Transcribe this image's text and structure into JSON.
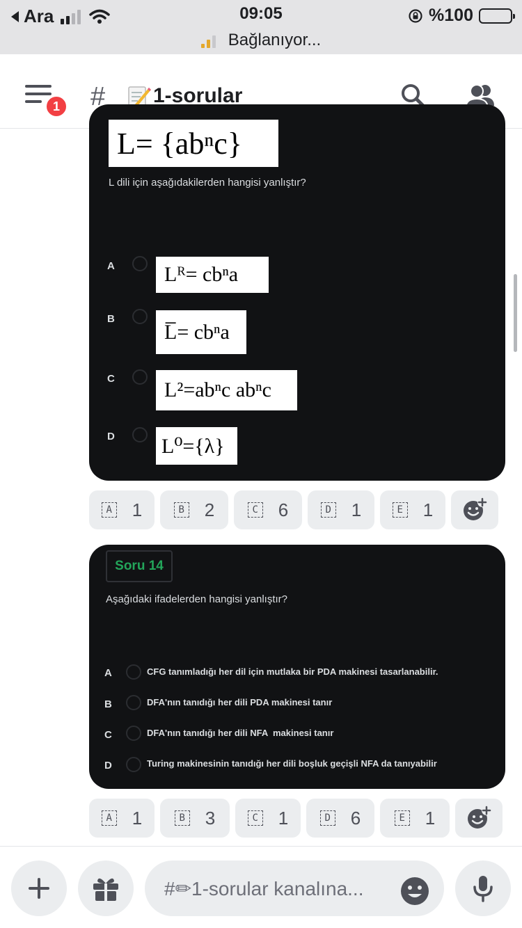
{
  "status_bar": {
    "carrier": "Ara",
    "time": "09:05",
    "battery": "%100",
    "connection_text": "Bağlanıyor..."
  },
  "header": {
    "notification_count": "1",
    "channel_hash": "#",
    "channel_name": "1-sorular",
    "icons": [
      "menu-icon",
      "memo-emoji-icon",
      "search-icon",
      "members-icon"
    ]
  },
  "message1": {
    "header_formula": "L= {abⁿc}",
    "question": "L dili için aşağıdakilerden hangisi yanlıştır?",
    "options": [
      {
        "letter": "A",
        "formula": "Lᴿ= cbⁿa"
      },
      {
        "letter": "B",
        "formula": "L̅= cbⁿa"
      },
      {
        "letter": "C",
        "formula": "L²=abⁿc abⁿc"
      },
      {
        "letter": "D",
        "formula": "L⁰={λ}"
      }
    ],
    "reactions": [
      {
        "emoji": "A",
        "count": "1"
      },
      {
        "emoji": "B",
        "count": "2"
      },
      {
        "emoji": "C",
        "count": "6"
      },
      {
        "emoji": "D",
        "count": "1"
      },
      {
        "emoji": "E",
        "count": "1"
      }
    ]
  },
  "message2": {
    "tag": "Soru 14",
    "question": "Aşağıdaki ifadelerden hangisi yanlıştır?",
    "options": [
      {
        "letter": "A",
        "text": "CFG tanımladığı her dil için mutlaka bir PDA makinesi tasarlanabilir."
      },
      {
        "letter": "B",
        "text": "DFA'nın tanıdığı her dili PDA makinesi tanır"
      },
      {
        "letter": "C",
        "text": "DFA'nın tanıdığı her dili NFA  makinesi tanır"
      },
      {
        "letter": "D",
        "text": "Turing makinesinin tanıdığı her dili boşluk geçişli NFA da tanıyabilir"
      }
    ],
    "reactions": [
      {
        "emoji": "A",
        "count": "1"
      },
      {
        "emoji": "B",
        "count": "3"
      },
      {
        "emoji": "C",
        "count": "1"
      },
      {
        "emoji": "D",
        "count": "6"
      },
      {
        "emoji": "E",
        "count": "1"
      }
    ]
  },
  "composer": {
    "placeholder": "#✏1-sorular kanalına..."
  },
  "colors": {
    "card_bg": "#111214",
    "accent_green": "#23a55a",
    "badge_red": "#f23f43",
    "reaction_bg": "#ebedef"
  }
}
